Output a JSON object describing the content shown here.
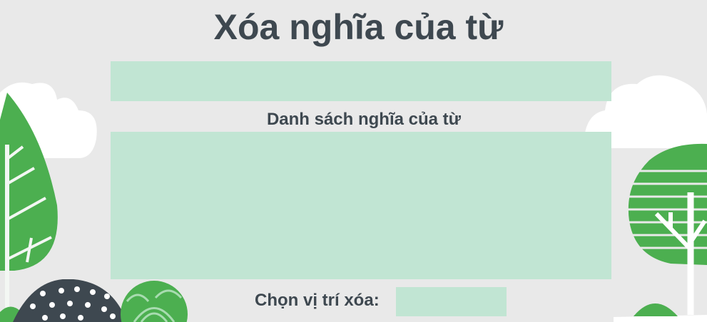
{
  "title": "Xóa nghĩa của từ",
  "word_input": {
    "value": ""
  },
  "meaning_list": {
    "label": "Danh sách nghĩa của từ",
    "items": []
  },
  "position": {
    "label": "Chọn vị trí xóa:",
    "value": ""
  },
  "colors": {
    "background": "#e9e9e9",
    "box": "#c1e5d3",
    "green": "#4caf50",
    "dark": "#3e4850"
  }
}
